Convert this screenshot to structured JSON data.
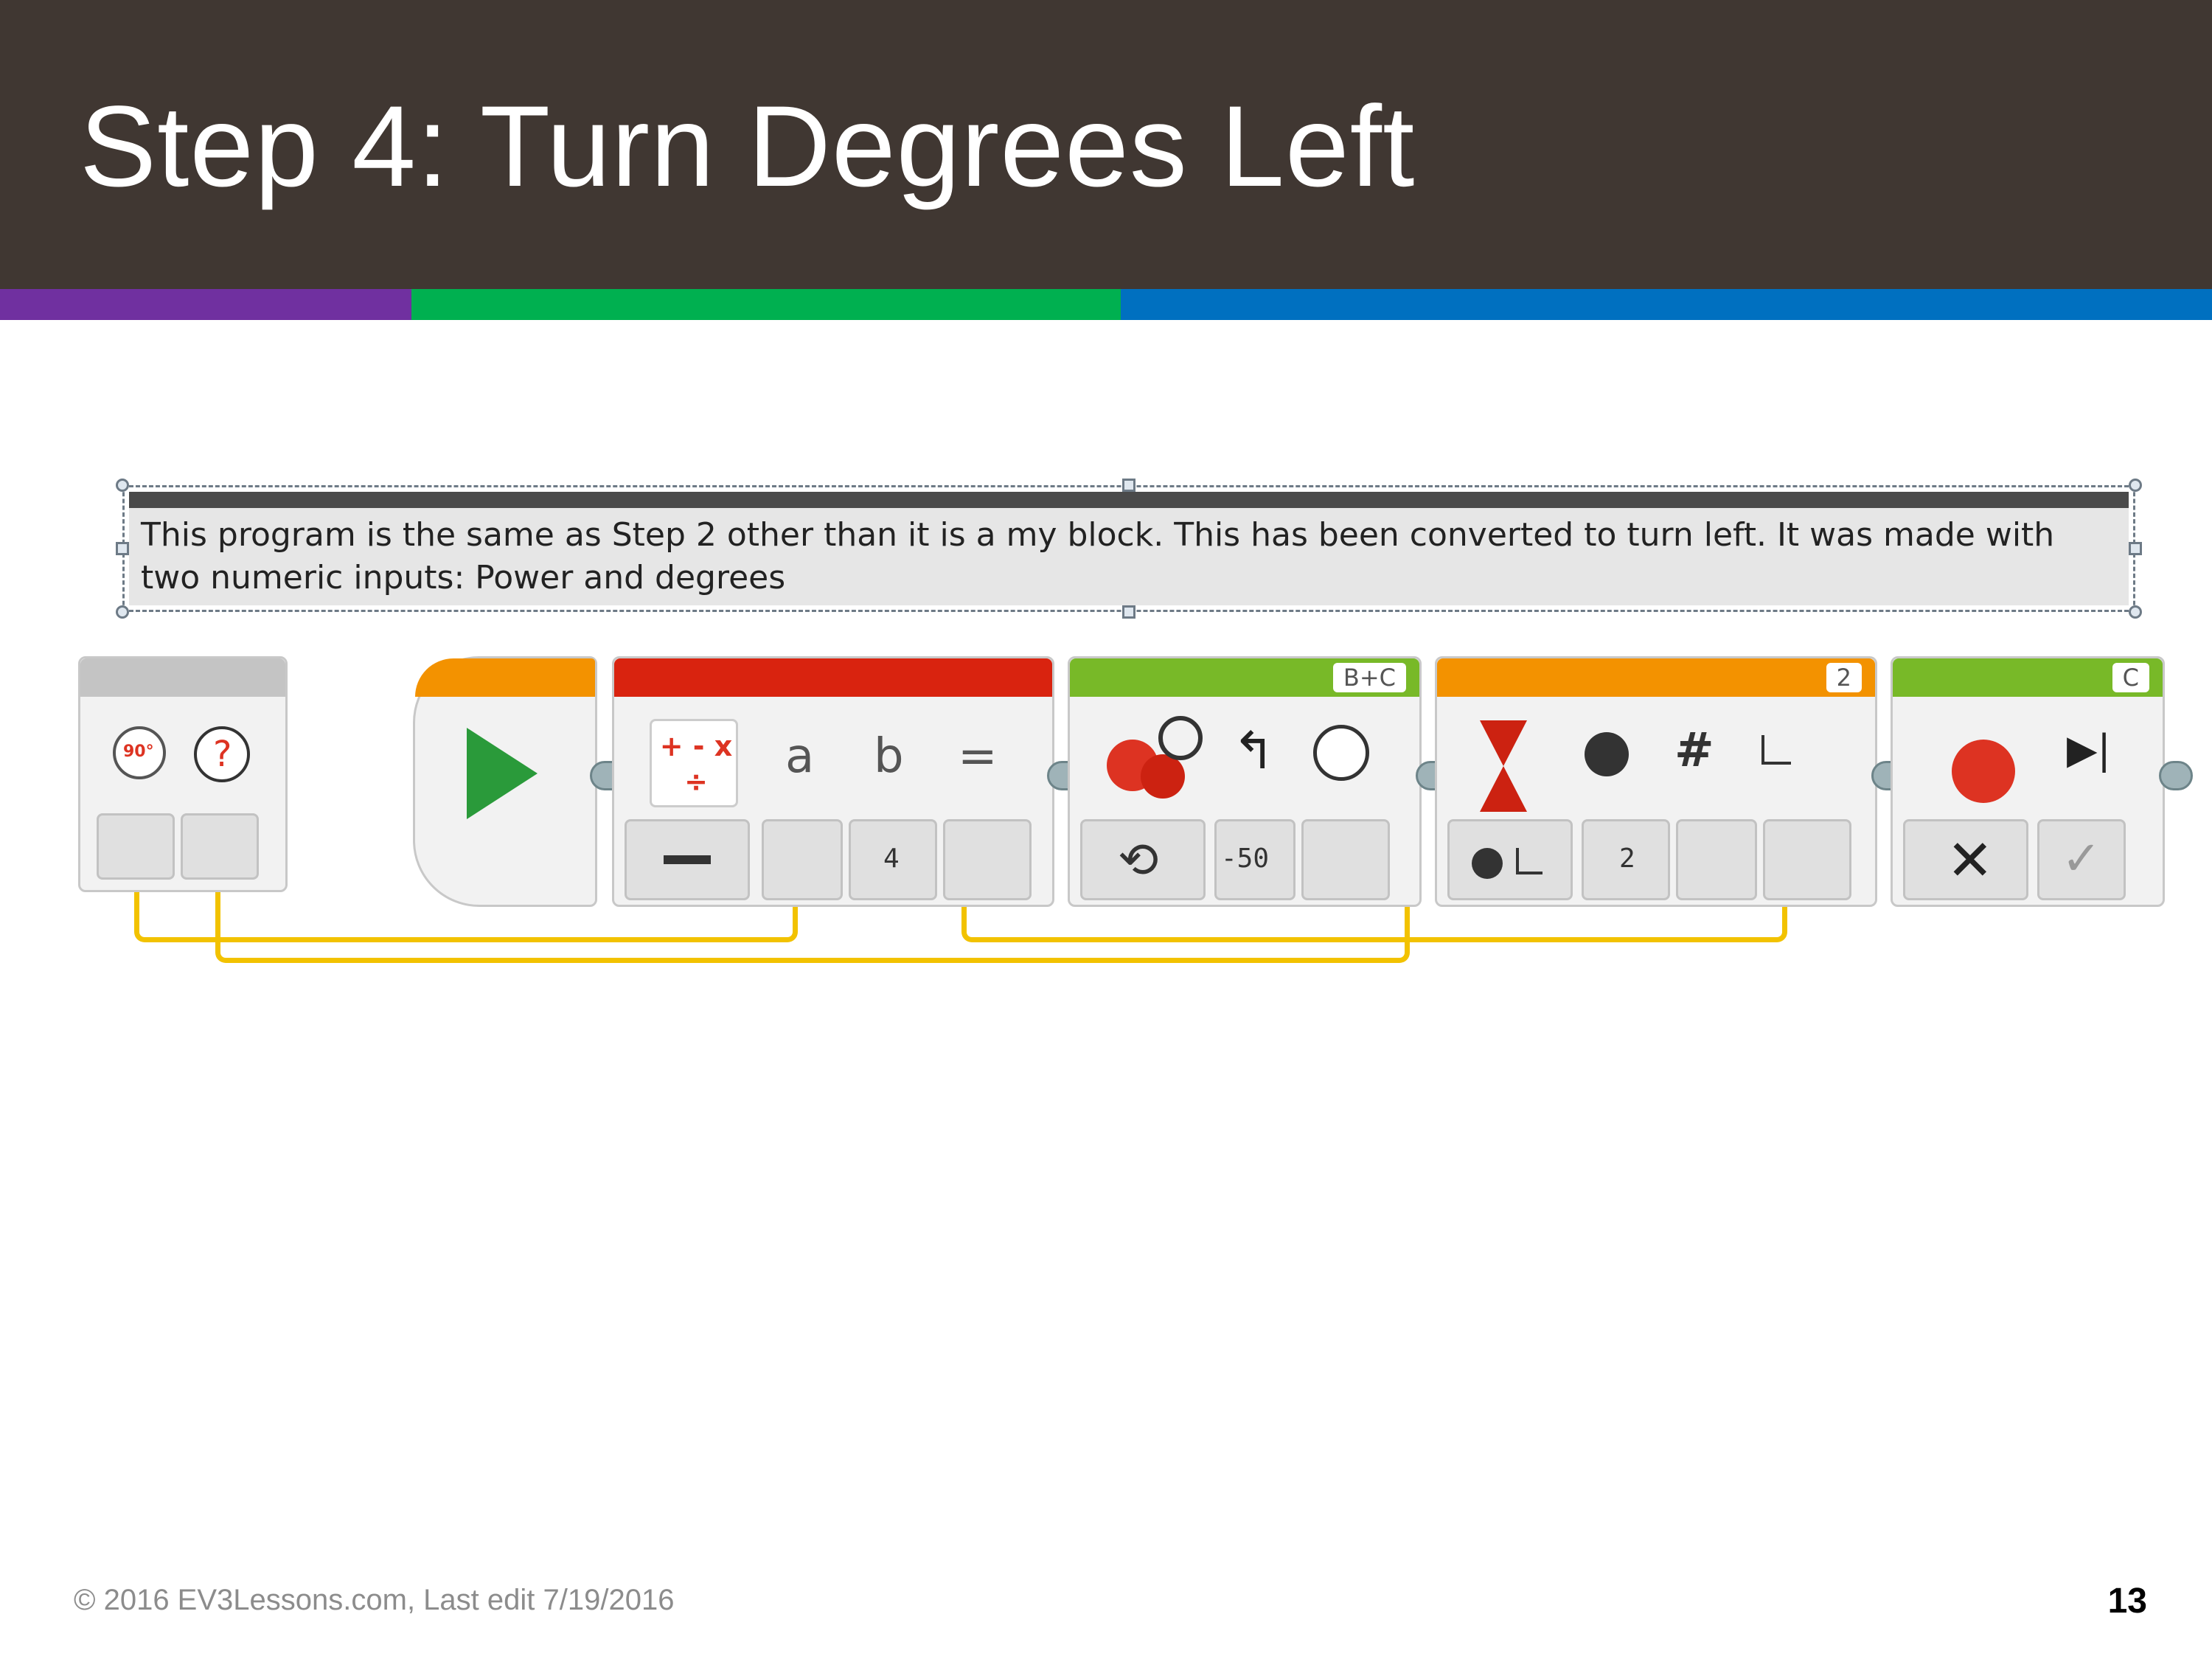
{
  "header": {
    "title": "Step 4: Turn Degrees Left"
  },
  "colors": {
    "header_bg": "#403732",
    "stripe_purple": "#7030a0",
    "stripe_green": "#00b050",
    "stripe_blue": "#0070c0",
    "wire": "#f2c200"
  },
  "comment": {
    "text": "This program is the same as Step 2 other than it is a my block. This has been converted to turn left. It was made with two numeric inputs: Power and degrees"
  },
  "program": {
    "myblock_inputs": {
      "degrees_icon_text": "90°",
      "power_icon_text": "?"
    },
    "math_block": {
      "symbols": "+ - x ÷",
      "a": "a",
      "b": "b",
      "eq": "=",
      "mode_icon": "minus-icon",
      "b_value": "4"
    },
    "steering_block": {
      "port": "B+C",
      "steering_value": "-50",
      "mode_icon": "rotation-icon"
    },
    "wait_block": {
      "port": "2",
      "hash": "#",
      "value": "2"
    },
    "motor_stop_block": {
      "port": "C",
      "stop_icon": "x-icon",
      "brake_icon": "check-icon"
    }
  },
  "footer": {
    "copyright": "© 2016 EV3Lessons.com, Last edit 7/19/2016",
    "page_number": "13"
  }
}
